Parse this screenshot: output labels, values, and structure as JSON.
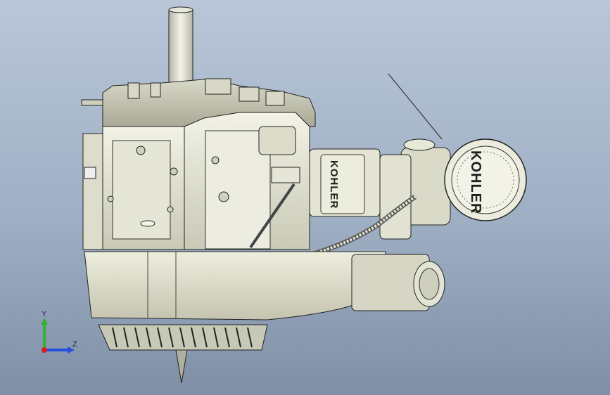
{
  "viewport": {
    "background_top": "#b9c6d8",
    "background_bottom": "#7f8fa6"
  },
  "model": {
    "brand_label_large": "KOHLER",
    "brand_label_small": "KOHLER"
  },
  "triad": {
    "y_label": "Y",
    "z_label": "Z",
    "y_axis_color": "#33b233",
    "z_axis_color": "#2450e0",
    "x_axis_color": "#d81e1e"
  }
}
